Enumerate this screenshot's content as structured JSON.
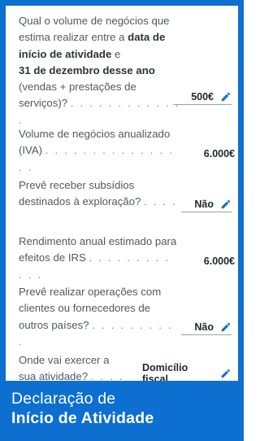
{
  "questions": [
    {
      "id": "volume",
      "parts": [
        {
          "text": "Qual o volume de negócios que estima realizar entre a ",
          "bold": false
        },
        {
          "text": "data de início de atividade",
          "bold": true
        },
        {
          "text": " e ",
          "bold": false
        },
        {
          "text": "31 de dezembro desse ano",
          "bold": true
        },
        {
          "text": " (vendas + prestações de serviços)?",
          "bold": false
        }
      ],
      "dots": ". . . . . . . . . . . . .",
      "answer": "500€",
      "editable": true
    },
    {
      "id": "annualized",
      "text": "Volume de negócios anualizado (IVA)",
      "dots": ". . . . . . . . . . . . . . . .",
      "answer": "6.000€",
      "editable": false
    },
    {
      "id": "subsidies",
      "text": "Prevê receber subsídios destinados à exploração?",
      "dots": ". . . .",
      "answer": "Não",
      "editable": true
    },
    {
      "id": "irs",
      "text": "Rendimento anual estimado para efeitos de IRS",
      "dots": ". . . . . . . . . . . .",
      "answer": "6.000€",
      "editable": false
    },
    {
      "id": "foreign",
      "text": "Prevê realizar operações com clientes ou fornecedores de outros países?",
      "dots": ". . . . . . . . . .",
      "answer": "Não",
      "editable": true
    },
    {
      "id": "location",
      "text": "Onde vai exercer a sua atividade?",
      "dots": ". . . .",
      "answer": "Domicílio fiscal",
      "editable": true
    }
  ],
  "banner": {
    "line1": "Declaração de",
    "line2": "Início de Atividade"
  },
  "colors": {
    "accent": "#0d6fd0",
    "text": "#4f5962",
    "answer": "#23282d"
  },
  "icons": {
    "edit": "pencil-icon"
  }
}
